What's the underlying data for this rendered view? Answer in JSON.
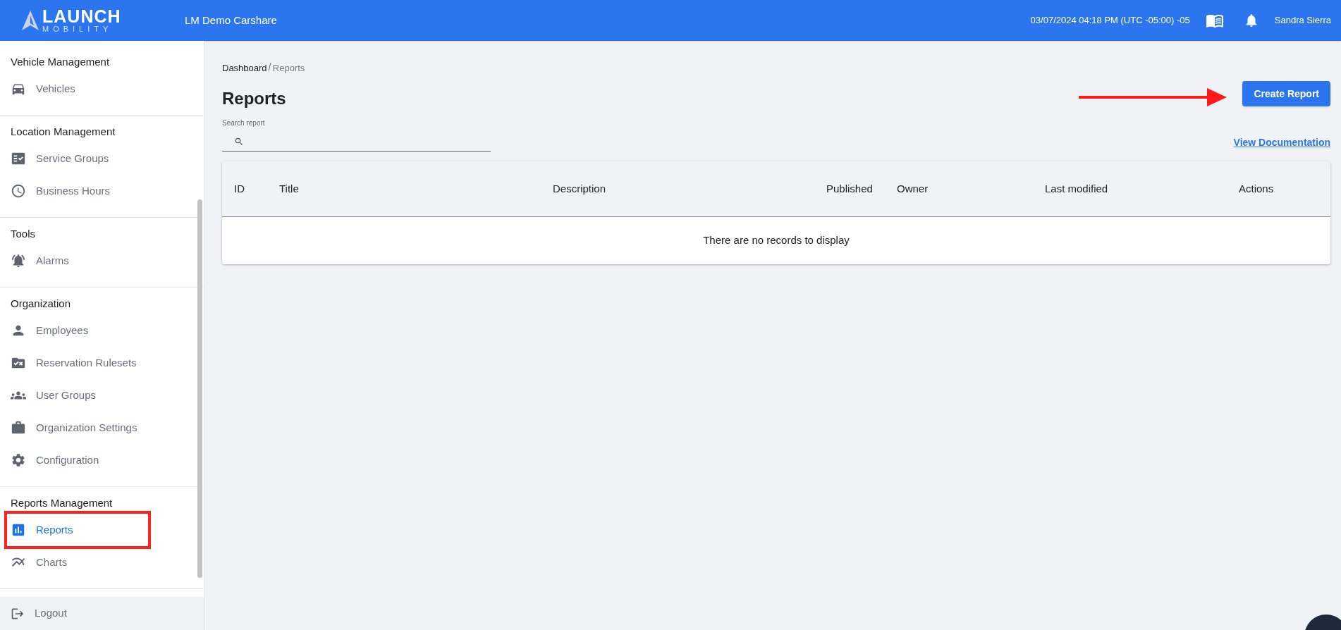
{
  "header": {
    "brand_top": "LAUNCH",
    "brand_bottom": "MOBILITY",
    "organization": "LM Demo Carshare",
    "datetime": "03/07/2024 04:18 PM (UTC -05:00) -05",
    "user": "Sandra Sierra"
  },
  "sidebar": {
    "sections": [
      {
        "title": "Vehicle Management",
        "items": [
          {
            "label": "Vehicles",
            "selected": false
          }
        ]
      },
      {
        "title": "Location Management",
        "items": [
          {
            "label": "Service Groups",
            "selected": false
          },
          {
            "label": "Business Hours",
            "selected": false
          }
        ]
      },
      {
        "title": "Tools",
        "items": [
          {
            "label": "Alarms",
            "selected": false
          }
        ]
      },
      {
        "title": "Organization",
        "items": [
          {
            "label": "Employees",
            "selected": false
          },
          {
            "label": "Reservation Rulesets",
            "selected": false
          },
          {
            "label": "User Groups",
            "selected": false
          },
          {
            "label": "Organization Settings",
            "selected": false
          },
          {
            "label": "Configuration",
            "selected": false
          }
        ]
      },
      {
        "title": "Reports Management",
        "items": [
          {
            "label": "Reports",
            "selected": true,
            "highlighted": true
          },
          {
            "label": "Charts",
            "selected": false
          }
        ]
      }
    ],
    "logout": "Logout"
  },
  "breadcrumb": [
    {
      "label": "Dashboard"
    },
    {
      "label": "Reports"
    }
  ],
  "breadcrumb_separator": "/",
  "page_title": "Reports",
  "create_button": "Create Report",
  "search": {
    "label": "Search report"
  },
  "documentation_link": "View Documentation",
  "table": {
    "columns": [
      "ID",
      "Title",
      "Description",
      "Published",
      "Owner",
      "Last modified",
      "Actions"
    ],
    "empty_message": "There are no records to display"
  }
}
